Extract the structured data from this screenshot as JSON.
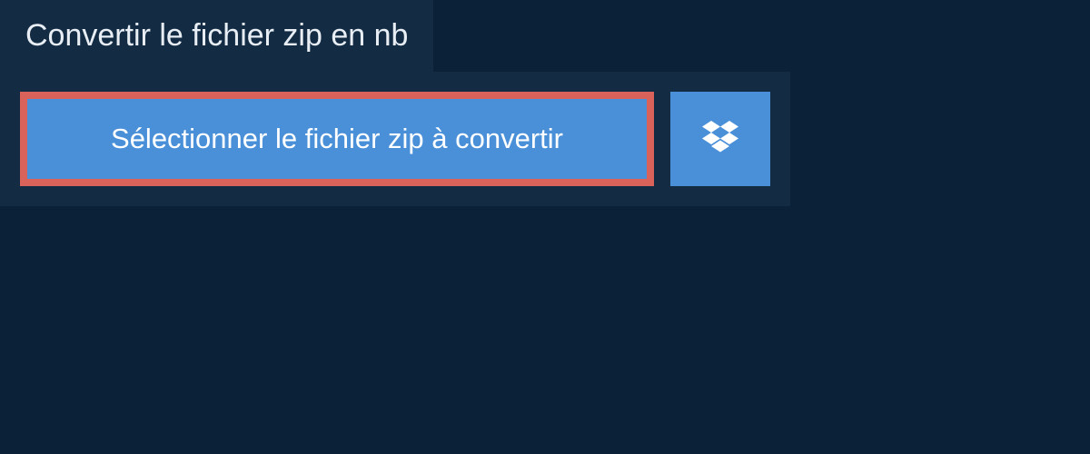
{
  "header": {
    "title": "Convertir le fichier zip en nb"
  },
  "actions": {
    "select_file_label": "Sélectionner le fichier zip à convertir"
  }
}
